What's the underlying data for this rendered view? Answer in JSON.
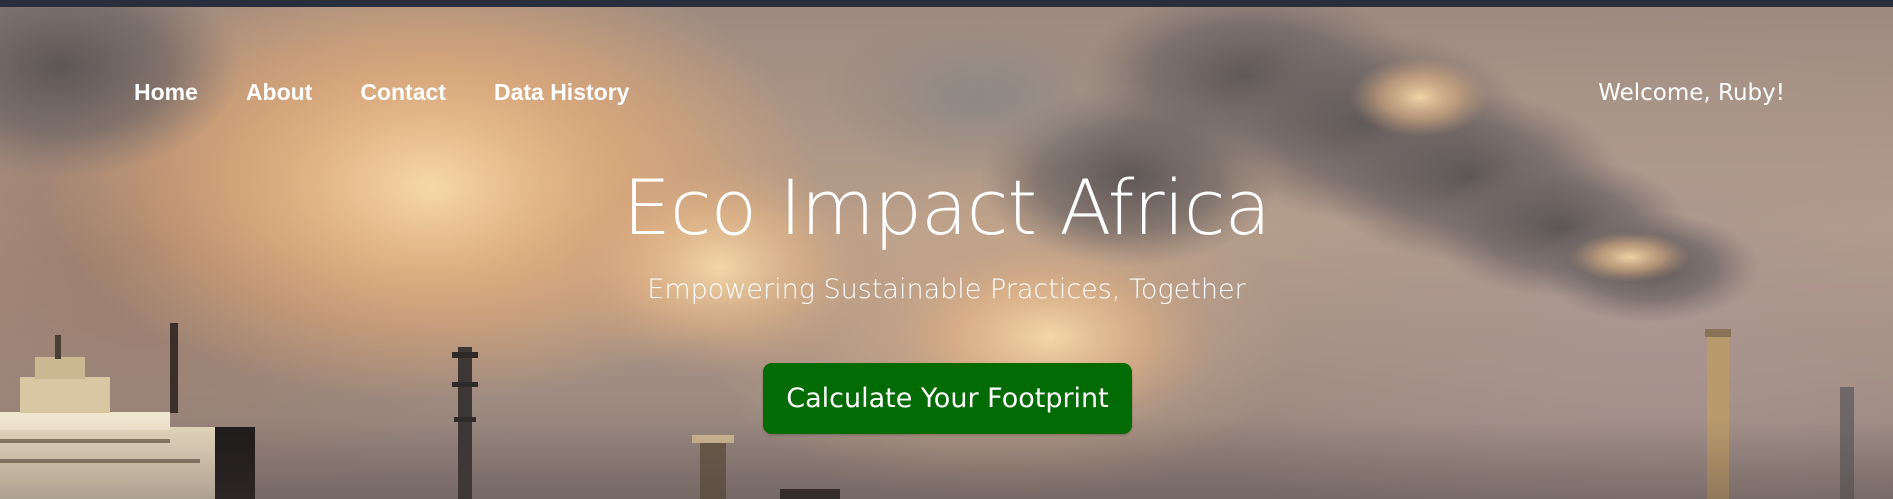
{
  "nav": {
    "items": [
      {
        "label": "Home"
      },
      {
        "label": "About"
      },
      {
        "label": "Contact"
      },
      {
        "label": "Data History"
      }
    ]
  },
  "user": {
    "welcome": "Welcome, Ruby!"
  },
  "hero": {
    "title": "Eco Impact Africa",
    "subtitle": "Empowering Sustainable Practices, Together",
    "cta_label": "Calculate Your Footprint"
  },
  "colors": {
    "cta_background": "#036b03",
    "text": "#ffffff",
    "topbar": "#2a2d3b"
  }
}
